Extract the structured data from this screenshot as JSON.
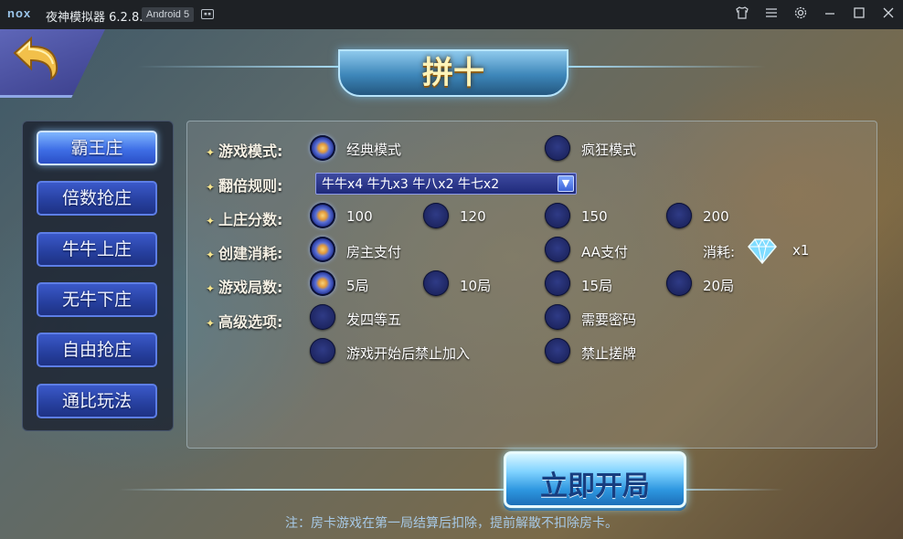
{
  "window": {
    "logo": "nox",
    "title": "夜神模拟器 6.2.8.1",
    "android_badge": "Android 5",
    "controls": [
      "shirt-icon",
      "menu-icon",
      "gear-icon",
      "minimize-icon",
      "maximize-icon",
      "close-icon"
    ]
  },
  "header": {
    "title": "拼十",
    "back_icon": "back-arrow-icon"
  },
  "sidebar": {
    "items": [
      {
        "label": "霸王庄",
        "active": true
      },
      {
        "label": "倍数抢庄",
        "active": false
      },
      {
        "label": "牛牛上庄",
        "active": false
      },
      {
        "label": "无牛下庄",
        "active": false
      },
      {
        "label": "自由抢庄",
        "active": false
      },
      {
        "label": "通比玩法",
        "active": false
      }
    ]
  },
  "options": {
    "game_mode": {
      "label": "游戏模式:",
      "choices": [
        {
          "label": "经典模式",
          "selected": true
        },
        {
          "label": "疯狂模式",
          "selected": false
        }
      ]
    },
    "multiplier_rule": {
      "label": "翻倍规则:",
      "value": "牛牛x4 牛九x3 牛八x2 牛七x2"
    },
    "banker_score": {
      "label": "上庄分数:",
      "choices": [
        {
          "label": "100",
          "selected": true
        },
        {
          "label": "120",
          "selected": false
        },
        {
          "label": "150",
          "selected": false
        },
        {
          "label": "200",
          "selected": false
        }
      ]
    },
    "create_cost": {
      "label": "创建消耗:",
      "choices": [
        {
          "label": "房主支付",
          "selected": true
        },
        {
          "label": "AA支付",
          "selected": false
        }
      ],
      "cost_label": "消耗:",
      "cost_value": "x1",
      "cost_icon": "diamond-icon"
    },
    "rounds": {
      "label": "游戏局数:",
      "choices": [
        {
          "label": "5局",
          "selected": true
        },
        {
          "label": "10局",
          "selected": false
        },
        {
          "label": "15局",
          "selected": false
        },
        {
          "label": "20局",
          "selected": false
        }
      ]
    },
    "advanced": {
      "label": "高级选项:",
      "choices": [
        {
          "label": "发四等五",
          "selected": false
        },
        {
          "label": "需要密码",
          "selected": false
        },
        {
          "label": "游戏开始后禁止加入",
          "selected": false
        },
        {
          "label": "禁止搓牌",
          "selected": false
        }
      ]
    }
  },
  "start_button": {
    "label": "立即开局"
  },
  "note": "注：房卡游戏在第一局结算后扣除，提前解散不扣除房卡。",
  "colors": {
    "titlebar_bg": "#1e2125",
    "title_gold": "#fff3b8",
    "sidebar_button": "#2a44a8",
    "note_text": "#a7c9e6"
  }
}
